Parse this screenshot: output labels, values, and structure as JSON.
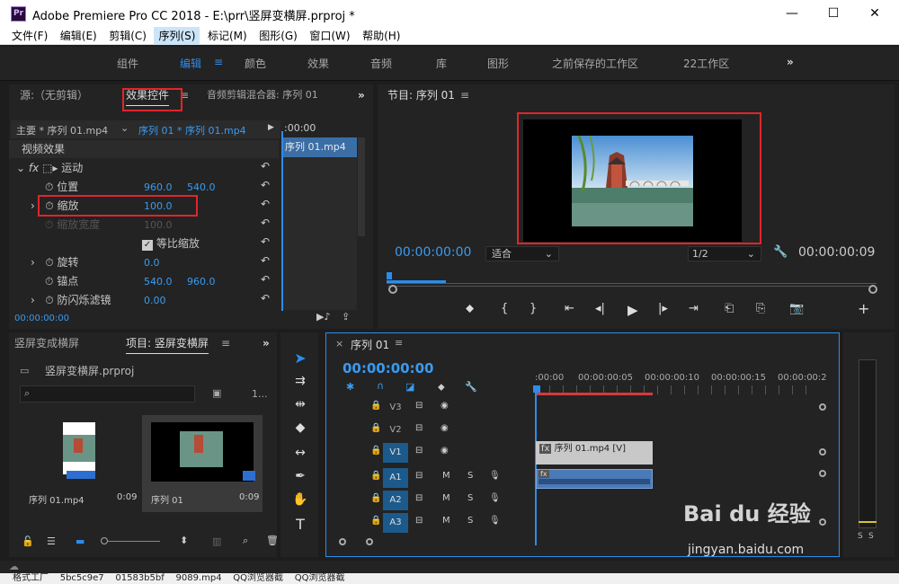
{
  "window": {
    "title": "Adobe Premiere Pro CC 2018 - E:\\prr\\竖屏变横屏.prproj *",
    "logo": "Pr",
    "minimize": "—",
    "maximize": "☐",
    "close": "✕"
  },
  "menu": [
    "文件(F)",
    "编辑(E)",
    "剪辑(C)",
    "序列(S)",
    "标记(M)",
    "图形(G)",
    "窗口(W)",
    "帮助(H)"
  ],
  "workspaces": [
    "组件",
    "编辑",
    "颜色",
    "效果",
    "音频",
    "库",
    "图形",
    "之前保存的工作区",
    "22工作区"
  ],
  "workspace_more": "»",
  "source_panel": {
    "tabs": [
      "源:（无剪辑）",
      "效果控件",
      "音频剪辑混合器: 序列 01"
    ],
    "more": "»",
    "master": "主要 * 序列 01.mp4",
    "sequence_clip": "序列 01 * 序列 01.mp4",
    "time_label": ":00:00",
    "clip_label": "序列 01.mp4",
    "section": "视频效果",
    "motion": "运动",
    "fx": "fx",
    "position_label": "位置",
    "position_x": "960.0",
    "position_y": "540.0",
    "scale_label": "缩放",
    "scale_value": "100.0",
    "scale_width_label": "缩放宽度",
    "scale_width_value": "100.0",
    "uniform_label": "等比缩放",
    "rotation_label": "旋转",
    "rotation_value": "0.0",
    "anchor_label": "锚点",
    "anchor_x": "540.0",
    "anchor_y": "960.0",
    "flicker_label": "防闪烁滤镜",
    "flicker_value": "0.00",
    "timecode": "00:00:00:00"
  },
  "program": {
    "title": "节目: 序列 01",
    "timecode": "00:00:00:00",
    "fit": "适合",
    "quality": "1/2",
    "duration": "00:00:00:09"
  },
  "project": {
    "tabs": [
      "竖屏变成横屏",
      "项目: 竖屏变横屏"
    ],
    "more": "»",
    "file": "竖屏变横屏.prproj",
    "count": "1...",
    "items": [
      {
        "name": "序列 01.mp4",
        "duration": "0:09"
      },
      {
        "name": "序列 01",
        "duration": "0:09"
      }
    ]
  },
  "timeline": {
    "tab": "序列 01",
    "close": "×",
    "timecode": "00:00:00:00",
    "ruler": [
      ":00:00",
      "00:00:00:05",
      "00:00:00:10",
      "00:00:00:15",
      "00:00:00:2"
    ],
    "tracks": [
      "V3",
      "V2",
      "V1",
      "A1",
      "A2",
      "A3"
    ],
    "video_clip": "序列 01.mp4 [V]",
    "m": "M",
    "s": "S"
  },
  "meter": {
    "s1": "S",
    "s2": "S"
  },
  "watermark": {
    "brand": "Bai du 经验",
    "url": "jingyan.baidu.com"
  },
  "taskbar": "格式工厂    5bc5c9e7    01583b5bf    9089.mp4    QQ浏览器截    QQ浏览器截"
}
